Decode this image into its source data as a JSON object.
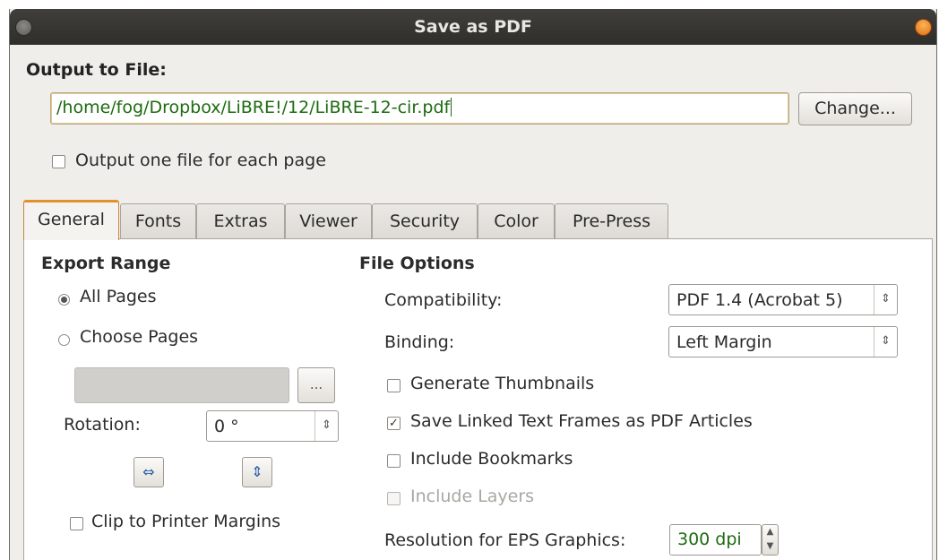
{
  "window": {
    "title": "Save as PDF"
  },
  "output": {
    "label": "Output to File:",
    "path": "/home/fog/Dropbox/LiBRE!/12/LiBRE-12-cir.pdf",
    "change_button": "Change...",
    "one_file_per_page": {
      "label": "Output one file for each page",
      "checked": false
    }
  },
  "tabs": [
    {
      "label": "General",
      "active": true
    },
    {
      "label": "Fonts",
      "active": false
    },
    {
      "label": "Extras",
      "active": false
    },
    {
      "label": "Viewer",
      "active": false
    },
    {
      "label": "Security",
      "active": false
    },
    {
      "label": "Color",
      "active": false
    },
    {
      "label": "Pre-Press",
      "active": false
    }
  ],
  "export_range": {
    "heading": "Export Range",
    "all_pages": {
      "label": "All Pages",
      "selected": true
    },
    "choose_pages": {
      "label": "Choose Pages",
      "selected": false
    },
    "browse_button": "...",
    "rotation_label": "Rotation:",
    "rotation_value": "0 °",
    "flip_h_icon": "flip-horizontal-icon",
    "flip_v_icon": "flip-vertical-icon",
    "clip_margins": {
      "label": "Clip to Printer Margins",
      "checked": false
    }
  },
  "file_options": {
    "heading": "File Options",
    "compatibility_label": "Compatibility:",
    "compatibility_value": "PDF 1.4 (Acrobat 5)",
    "binding_label": "Binding:",
    "binding_value": "Left Margin",
    "generate_thumbnails": {
      "label": "Generate Thumbnails",
      "checked": false
    },
    "save_linked_frames": {
      "label": "Save Linked Text Frames as PDF Articles",
      "checked": true
    },
    "include_bookmarks": {
      "label": "Include Bookmarks",
      "checked": false
    },
    "include_layers": {
      "label": "Include Layers",
      "checked": false,
      "disabled": true
    },
    "resolution_label": "Resolution for EPS Graphics:",
    "resolution_value": "300 dpi"
  },
  "colors": {
    "accent_tab": "#e3902e",
    "value_text": "#1d6b10",
    "titlebar": "#2f2e2a"
  }
}
